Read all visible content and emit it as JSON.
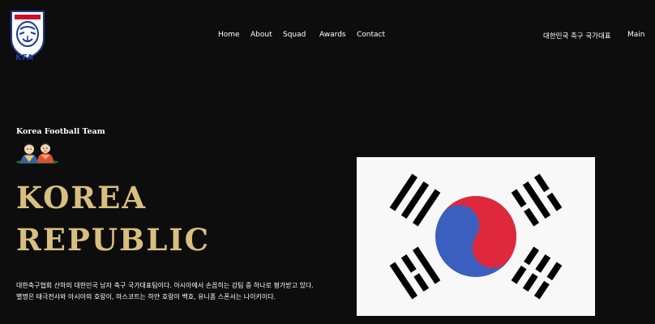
{
  "brand": {
    "logo_text": "KFA"
  },
  "nav": {
    "home": "Home",
    "about": "About",
    "squad": "Squad",
    "awards": "Awards",
    "contact": "Contact",
    "team_link": "대한민국 축구 국가대표",
    "main": "Main"
  },
  "hero": {
    "eyebrow": "Korea Football Team",
    "title_line1": "KOREA",
    "title_line2": "REPUBLIC",
    "description": "대한축구협회 산하의 대한민국 남자 축구 국가대표팀이다. 아시아에서 손꼽히는 강팀 중 하나로 평가받고 있다. 별명은 태극전사와 아시아의 호랑이, 마스코트는 하얀 호랑이 백호, 유니폼 스폰서는 나이키이다."
  },
  "colors": {
    "background": "#0d0d0d",
    "title_gold": "#d9bf7f",
    "flag_red": "#e0283c",
    "flag_blue": "#3b5fbe",
    "logo_blue": "#1d3a8f"
  },
  "icons": {
    "logo": "kfa-tiger-emblem-icon",
    "mascots": "mascot-characters-icon",
    "flag": "south-korea-flag"
  }
}
